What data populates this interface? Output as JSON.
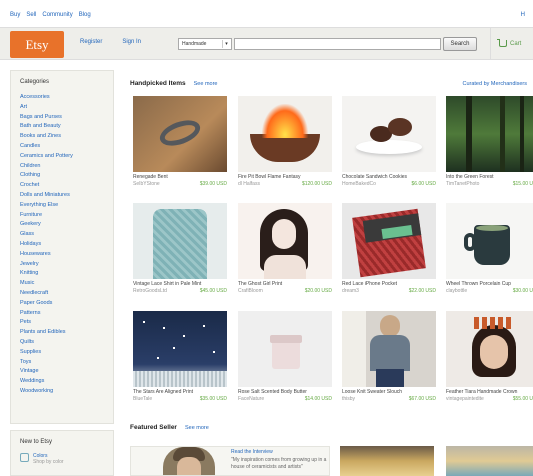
{
  "topnav": {
    "links": [
      "Buy",
      "Sell",
      "Community",
      "Blog"
    ],
    "right": "H"
  },
  "header": {
    "logo": "Etsy",
    "nav": [
      "Register",
      "Sign In"
    ],
    "search_select": "Handmade",
    "search_placeholder": "",
    "search_button": "Search",
    "cart_label": "Cart"
  },
  "sidebar": {
    "title": "Categories",
    "items": [
      "Accessories",
      "Art",
      "Bags and Purses",
      "Bath and Beauty",
      "Books and Zines",
      "Candles",
      "Ceramics and Pottery",
      "Children",
      "Clothing",
      "Crochet",
      "Dolls and Miniatures",
      "Everything Else",
      "Furniture",
      "Geekery",
      "Glass",
      "Holidays",
      "Housewares",
      "Jewelry",
      "Knitting",
      "Music",
      "Needlecraft",
      "Paper Goods",
      "Patterns",
      "Pets",
      "Plants and Edibles",
      "Quilts",
      "Supplies",
      "Toys",
      "Vintage",
      "Weddings",
      "Woodworking"
    ]
  },
  "new_box": {
    "title": "New to Etsy",
    "link": "Colors",
    "sub": "Shop by color"
  },
  "handpicked": {
    "title": "Handpicked Items",
    "more": "See more",
    "right_link": "Curated by Merchandisers",
    "items": [
      {
        "title": "Renegade Bent",
        "shop": "SeIbYStone",
        "price": "$39.00 USD",
        "img": "ring"
      },
      {
        "title": "Fire Pit Bowl Flame Fantasy",
        "shop": "dl Halfass",
        "price": "$120.00 USD",
        "img": "fire"
      },
      {
        "title": "Chocolate Sandwich Cookies",
        "shop": "HomeBakedCo",
        "price": "$6.00 USD",
        "img": "cookies"
      },
      {
        "title": "Into the Green Forest",
        "shop": "TimTanetPhoto",
        "price": "$15.00 USD",
        "img": "forest"
      },
      {
        "title": "Vintage Lace Shirt in Pale Mint",
        "shop": "RetroGoodsLtd",
        "price": "$45.00 USD",
        "img": "lace"
      },
      {
        "title": "The Ghost Girl Print",
        "shop": "CrafiBloom",
        "price": "$20.00 USD",
        "img": "girl"
      },
      {
        "title": "Red Lace iPhone Pocket",
        "shop": "dream3",
        "price": "$22.00 USD",
        "img": "pouch"
      },
      {
        "title": "Wheel Thrown Porcelain Cup",
        "shop": "claybottle",
        "price": "$30.00 USD",
        "img": "mug"
      },
      {
        "title": "The Stars Are Aligned Print",
        "shop": "BlueTale",
        "price": "$35.00 USD",
        "img": "stars"
      },
      {
        "title": "Rose Salt Scented Body Butter",
        "shop": "FaceNature",
        "price": "$14.00 USD",
        "img": "jar"
      },
      {
        "title": "Loose Knit Sweater Slouch",
        "shop": "thisby",
        "price": "$67.00 USD",
        "img": "sweater"
      },
      {
        "title": "Feather Tiara Handmade Crown",
        "shop": "vintagepaintedite",
        "price": "$55.00 USD",
        "img": "crown"
      }
    ]
  },
  "featured": {
    "title": "Featured Seller",
    "more": "See more",
    "seller_link": "Read the Interview",
    "quote": "\"My inspiration comes from growing up in a house of ceramicists and artists\""
  }
}
